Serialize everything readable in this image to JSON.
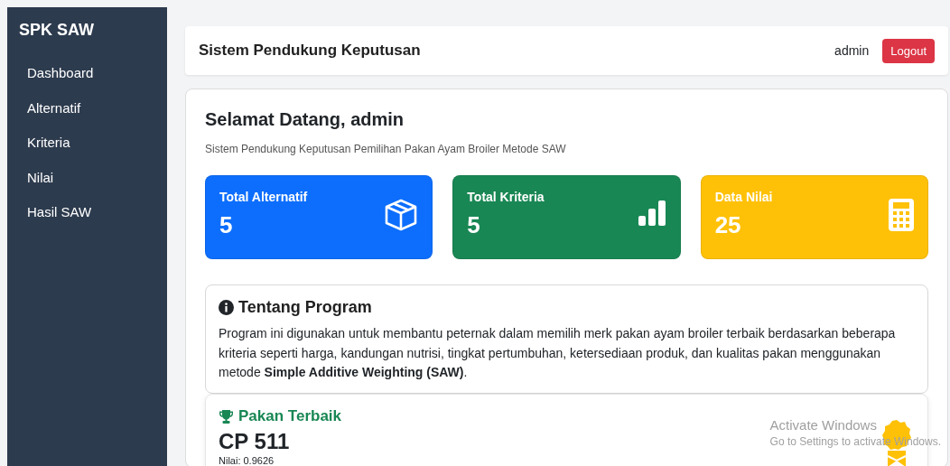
{
  "sidebar": {
    "brand": "SPK SAW",
    "items": [
      {
        "label": "Dashboard",
        "selected": false
      },
      {
        "label": "Alternatif",
        "selected": false
      },
      {
        "label": "Kriteria",
        "selected": false
      },
      {
        "label": "Nilai",
        "selected": false
      },
      {
        "label": "Hasil SAW",
        "selected": false
      }
    ]
  },
  "header": {
    "title": "Sistem Pendukung Keputusan",
    "user": "admin",
    "logout": "Logout"
  },
  "welcome": {
    "title": "Selamat Datang, admin",
    "subtitle": "Sistem Pendukung Keputusan Pemilihan Pakan Ayam Broiler Metode SAW"
  },
  "stats": [
    {
      "label": "Total Alternatif",
      "value": "5",
      "kind": "box",
      "color": "#0d6efd"
    },
    {
      "label": "Total Kriteria",
      "value": "5",
      "kind": "chart",
      "color": "#198754"
    },
    {
      "label": "Data Nilai",
      "value": "25",
      "kind": "calculator",
      "color": "#ffc107"
    }
  ],
  "about": {
    "title": "Tentang Program",
    "text": "Program ini digunakan untuk membantu peternak dalam memilih merk pakan ayam broiler terbaik berdasarkan beberapa kriteria seperti harga, kandungan nutrisi, tingkat pertumbuhan, ketersediaan produk, dan kualitas pakan menggunakan metode **Simple Additive Weighting (SAW)**."
  },
  "best": {
    "title": "Pakan Terbaik",
    "name": "CP 511",
    "score": "Nilai: 0.9626"
  },
  "os_overlay": {
    "title": "Activate Windows",
    "text": "Go to Settings to activate Windows."
  }
}
